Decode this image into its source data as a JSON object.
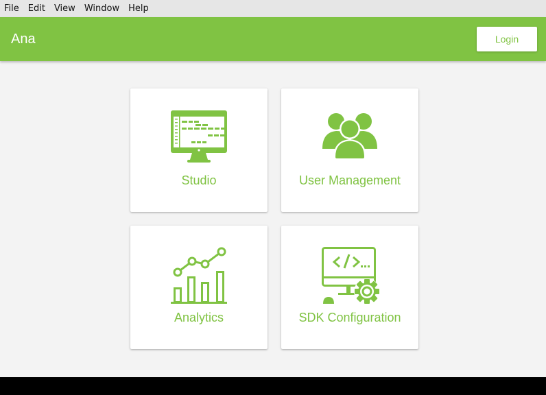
{
  "menu": [
    "File",
    "Edit",
    "View",
    "Window",
    "Help"
  ],
  "app": {
    "title": "Ana",
    "login_label": "Login"
  },
  "colors": {
    "accent": "#80c343",
    "menubar": "#e6e6e6",
    "background": "#f3f3f3"
  },
  "cards": [
    {
      "label": "Studio",
      "icon": "monitor-flow-icon"
    },
    {
      "label": "User Management",
      "icon": "users-group-icon"
    },
    {
      "label": "Analytics",
      "icon": "bar-chart-trend-icon"
    },
    {
      "label": "SDK Configuration",
      "icon": "code-settings-icon"
    }
  ]
}
